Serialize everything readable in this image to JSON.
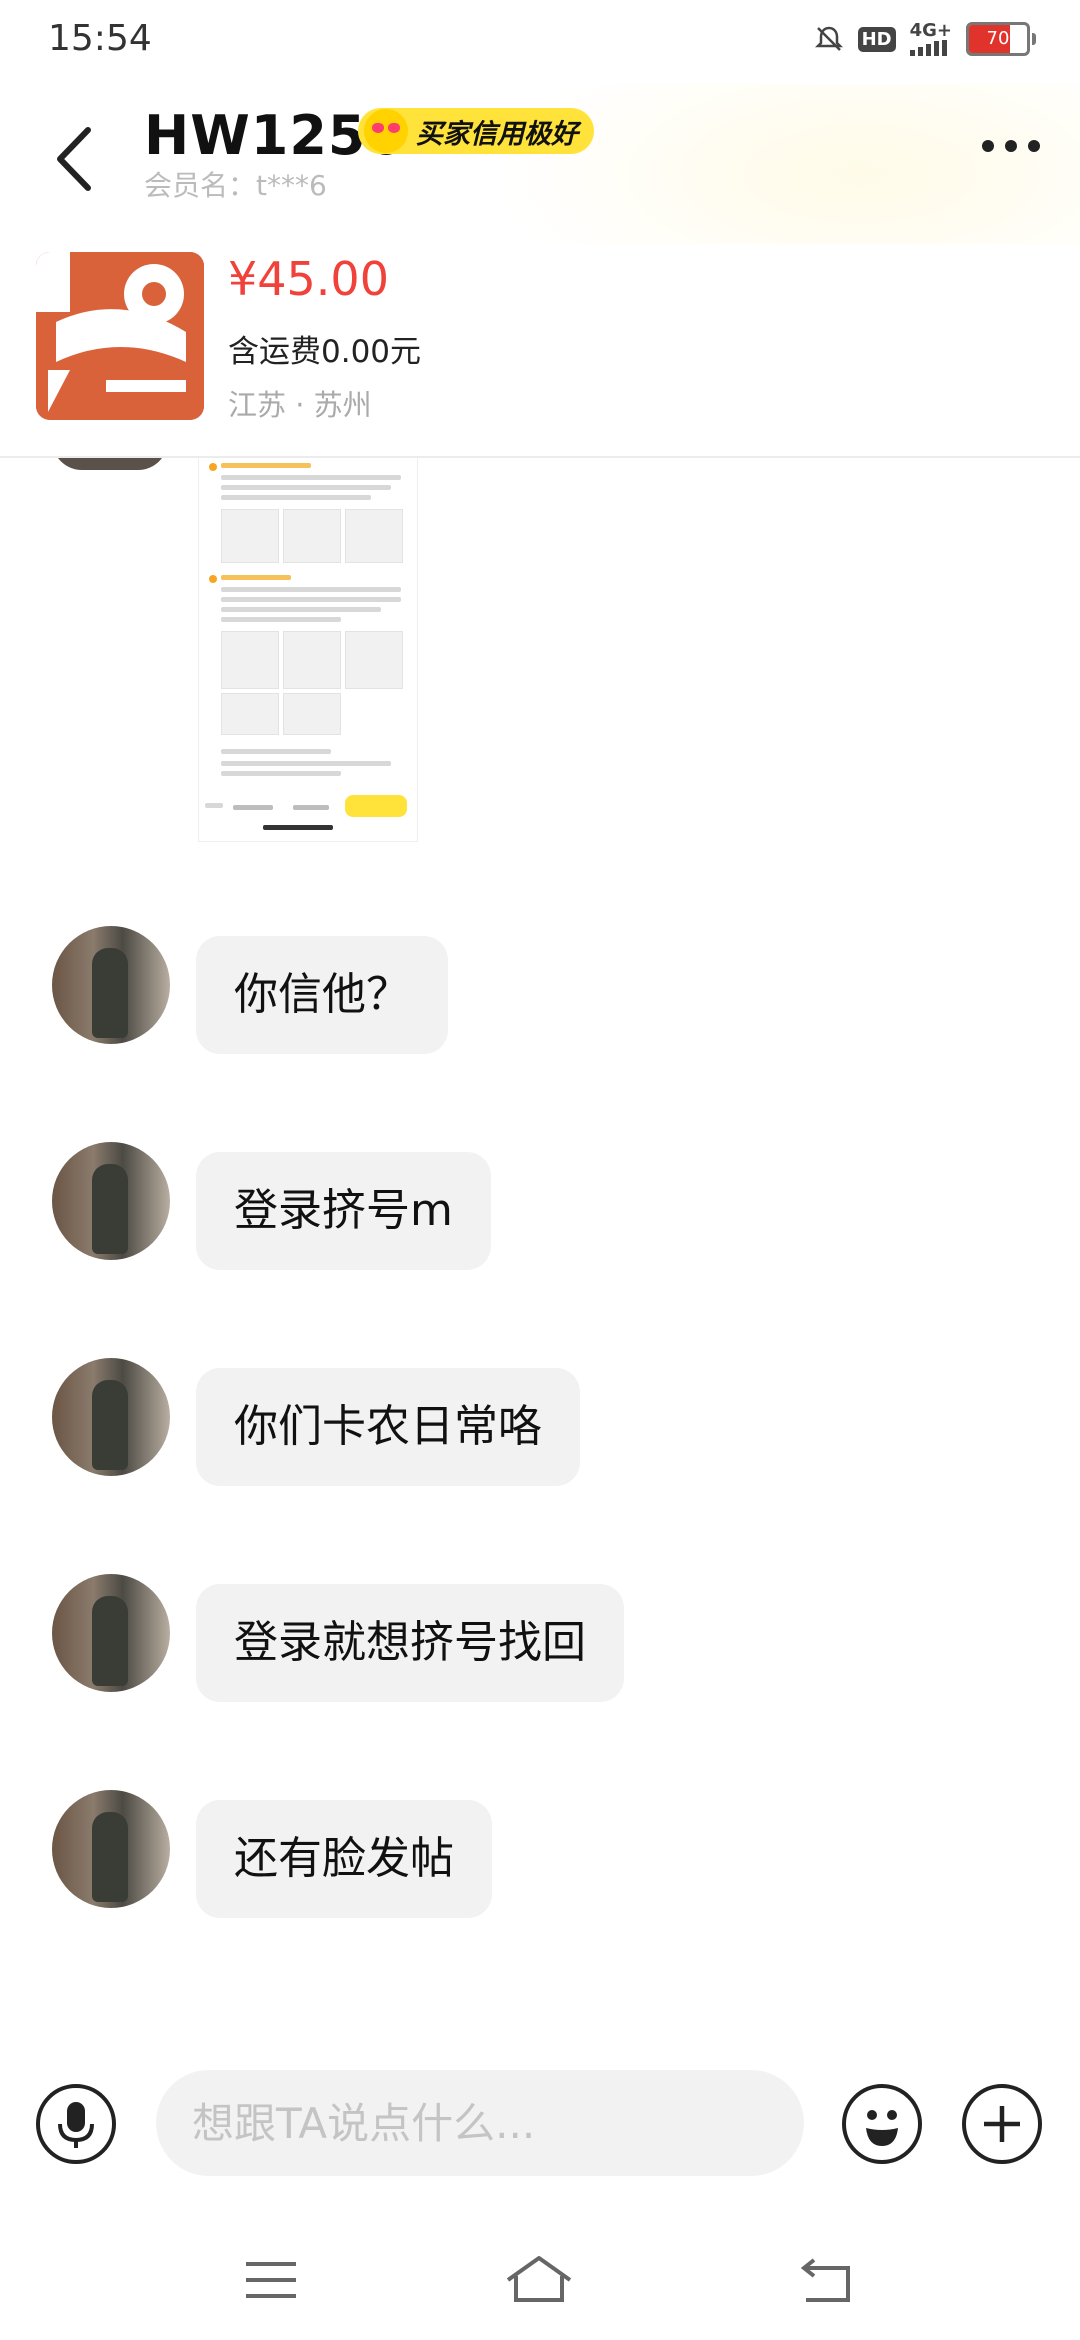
{
  "status_bar": {
    "time": "15:54",
    "icons": [
      "bell-off-icon",
      "hd-icon",
      "4g-signal-icon",
      "battery-icon"
    ],
    "hd_label": "HD",
    "network_label": "4G+",
    "battery_level": "70"
  },
  "header": {
    "title": "HW1256",
    "badge_text": "买家信用极好",
    "member_name": "会员名：t***6"
  },
  "product": {
    "price": "¥45.00",
    "shipping": "含运费0.00元",
    "location": "江苏 · 苏州"
  },
  "messages": [
    {
      "text": "你信他？"
    },
    {
      "text": "登录挤号m"
    },
    {
      "text": "你们卡农日常咯"
    },
    {
      "text": "登录就想挤号找回"
    },
    {
      "text": "还有脸发帖"
    }
  ],
  "input": {
    "placeholder": "想跟TA说点什么..."
  },
  "colors": {
    "price": "#f0423a",
    "badge": "#ffe33b",
    "bubble": "#f2f2f2"
  }
}
